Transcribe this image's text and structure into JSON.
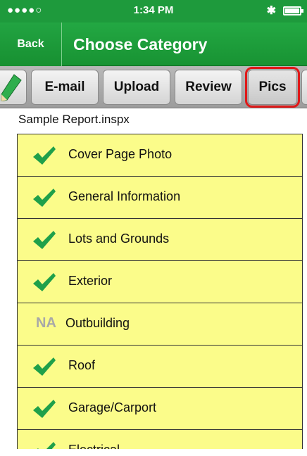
{
  "status_bar": {
    "signal": "●●●●○",
    "wifi": "≈",
    "time": "1:34 PM",
    "bluetooth": "✱"
  },
  "nav": {
    "back_label": "Back",
    "title": "Choose Category"
  },
  "toolbar": {
    "buttons": [
      {
        "label": "E-mail"
      },
      {
        "label": "Upload"
      },
      {
        "label": "Review"
      },
      {
        "label": "Pics"
      }
    ],
    "highlighted": "Pics"
  },
  "report_name": "Sample Report.inspx",
  "categories": [
    {
      "label": "Cover Page Photo",
      "status": "checked"
    },
    {
      "label": "General Information",
      "status": "checked"
    },
    {
      "label": "Lots and Grounds",
      "status": "checked"
    },
    {
      "label": "Exterior",
      "status": "checked"
    },
    {
      "label": "Outbuilding",
      "status": "na",
      "badge": "NA"
    },
    {
      "label": "Roof",
      "status": "checked"
    },
    {
      "label": "Garage/Carport",
      "status": "checked"
    },
    {
      "label": "Electrical",
      "status": "checked"
    }
  ],
  "colors": {
    "nav_green": "#1e9a3c",
    "item_yellow": "#fbfc8a",
    "check_green": "#1fa04a",
    "highlight_red": "#e01818"
  }
}
